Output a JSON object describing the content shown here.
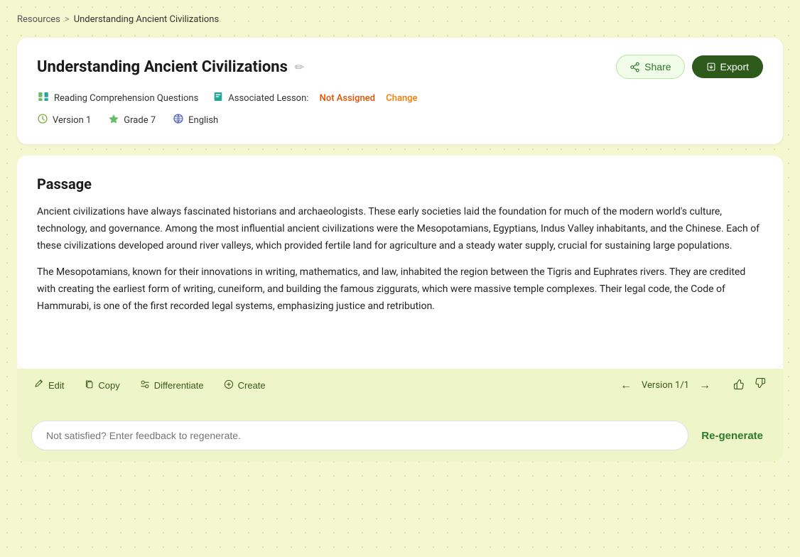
{
  "breadcrumb": {
    "link_label": "Resources",
    "separator": ">",
    "current": "Understanding Ancient Civilizations"
  },
  "header_card": {
    "title": "Understanding Ancient Civilizations",
    "edit_icon": "✏",
    "share_label": "Share",
    "export_label": "Export",
    "meta": {
      "resource_type_icon": "📚",
      "resource_type": "Reading Comprehension Questions",
      "lesson_label": "Associated Lesson:",
      "lesson_value": "Not Assigned",
      "change_label": "Change",
      "version_icon": "🕐",
      "version": "Version 1",
      "grade_icon": "🎓",
      "grade": "Grade 7",
      "language_icon": "🌐",
      "language": "English"
    }
  },
  "passage": {
    "title": "Passage",
    "paragraphs": [
      "Ancient civilizations have always fascinated historians and archaeologists. These early societies laid the foundation for much of the modern world's culture, technology, and governance. Among the most influential ancient civilizations were the Mesopotamians, Egyptians, Indus Valley inhabitants, and the Chinese. Each of these civilizations developed around river valleys, which provided fertile land for agriculture and a steady water supply, crucial for sustaining large populations.",
      "The Mesopotamians, known for their innovations in writing, mathematics, and law, inhabited the region between the Tigris and Euphrates rivers. They are credited with creating the earliest form of writing, cuneiform, and building the famous ziggurats, which were massive temple complexes. Their legal code, the Code of Hammurabi, is one of the first recorded legal systems, emphasizing justice and retribution."
    ]
  },
  "toolbar": {
    "edit_label": "Edit",
    "copy_label": "Copy",
    "differentiate_label": "Differentiate",
    "create_label": "Create",
    "version_label": "Version 1/1",
    "thumbup_icon": "👍",
    "thumbdown_icon": "👎"
  },
  "feedback": {
    "placeholder": "Not satisfied? Enter feedback to regenerate.",
    "regenerate_label": "Re-generate"
  }
}
